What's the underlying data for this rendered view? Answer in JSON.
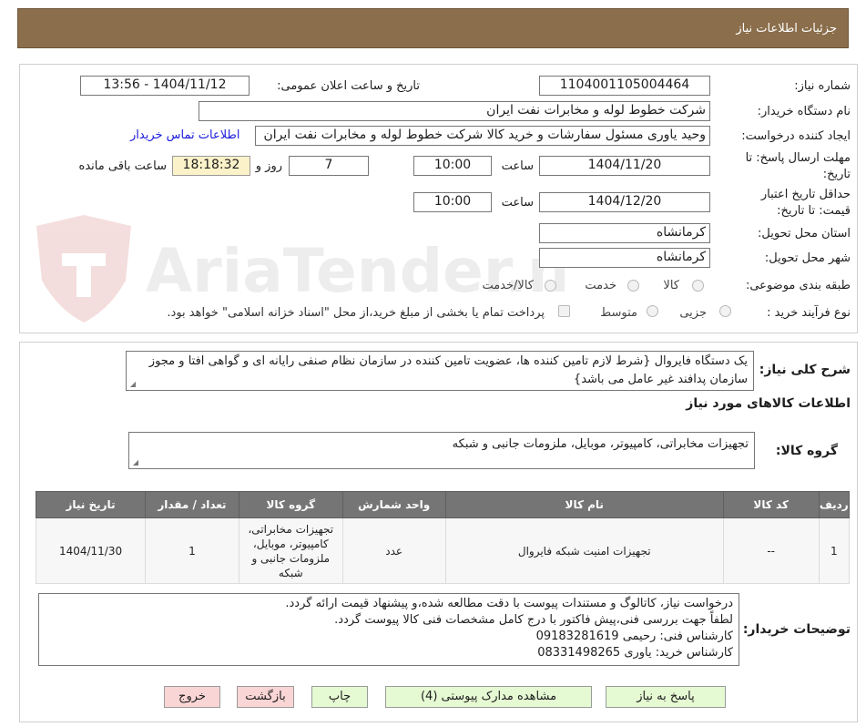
{
  "header": {
    "title": "جزئیات اطلاعات نیاز"
  },
  "form": {
    "need_number_label": "شماره نیاز:",
    "need_number": "1104001105004464",
    "announce_label": "تاریخ و ساعت اعلان عمومی:",
    "announce_value": "1404/11/12 - 13:56",
    "buyer_label": "نام دستگاه خریدار:",
    "buyer_value": "شرکت خطوط لوله و مخابرات نفت ایران",
    "requester_label": "ایجاد کننده درخواست:",
    "requester_value": "وحید یاوری مسئول سفارشات و خرید کالا  شرکت خطوط لوله و مخابرات نفت ایران",
    "contact_link": "اطلاعات تماس خریدار",
    "deadline_label_1": "مهلت ارسال پاسخ: تا",
    "deadline_label_2": "تاریخ:",
    "deadline_date": "1404/11/20",
    "time_label": "ساعت",
    "deadline_time": "10:00",
    "days_value": "7",
    "days_label": "روز و",
    "countdown": "18:18:32",
    "remaining_label": "ساعت باقی مانده",
    "validity_label_1": "حداقل تاریخ اعتبار",
    "validity_label_2": "قیمت: تا تاریخ:",
    "validity_date": "1404/12/20",
    "validity_time": "10:00",
    "province_label": "استان محل تحویل:",
    "province_value": "کرمانشاه",
    "city_label": "شهر محل تحویل:",
    "city_value": "کرمانشاه",
    "category_label": "طبقه بندی موضوعی:",
    "category_options": [
      "کالا",
      "خدمت",
      "کالا/خدمت"
    ],
    "process_label": "نوع فرآیند خرید :",
    "process_options": [
      "جزیی",
      "متوسط"
    ],
    "payment_note": "پرداخت تمام یا بخشی از مبلغ خرید،از محل \"اسناد خزانه اسلامی\" خواهد بود."
  },
  "summary": {
    "label": "شرح کلی نیاز:",
    "text": "یک دستگاه فایروال {شرط لازم تامین کننده ها، عضویت تامین کننده در سازمان نظام صنفی رایانه ای و گواهی افتا و مجوز سازمان پدافند غیر عامل می باشد}"
  },
  "goods_section_title": "اطلاعات کالاهای مورد نیاز",
  "goods_group": {
    "label": "گروه کالا:",
    "value": "تجهیزات مخابراتی، کامپیوتر، موبایل، ملزومات جانبی و شبکه"
  },
  "table": {
    "headers": [
      "ردیف",
      "کد کالا",
      "نام کالا",
      "واحد شمارش",
      "گروه کالا",
      "تعداد / مقدار",
      "تاریخ نیاز"
    ],
    "rows": [
      {
        "row": "1",
        "code": "--",
        "name": "تجهیزات امنیت شبکه فایروال",
        "unit": "عدد",
        "group": "تجهیزات مخابراتی، کامپیوتر، موبایل، ملزومات جانبی و شبکه",
        "qty": "1",
        "date": "1404/11/30"
      }
    ]
  },
  "buyer_notes": {
    "label": "توضیحات خریدار:",
    "lines": [
      "درخواست نیاز، کاتالوگ و مستندات پیوست با دقت مطالعه شده،و پیشنهاد قیمت ارائه گردد.",
      "لطفاً جهت بررسی فنی،پیش فاکتور با درج کامل مشخصات فنی کالا پیوست گردد.",
      "کارشناس فنی: رحیمی 09183281619",
      "کارشناس خرید: یاوری 08331498265"
    ]
  },
  "buttons": {
    "reply": "پاسخ به نیاز",
    "attachments": "مشاهده مدارک پیوستی (4)",
    "print": "چاپ",
    "back": "بازگشت",
    "exit": "خروج"
  },
  "watermark": {
    "text": "AriaTender.neT"
  }
}
